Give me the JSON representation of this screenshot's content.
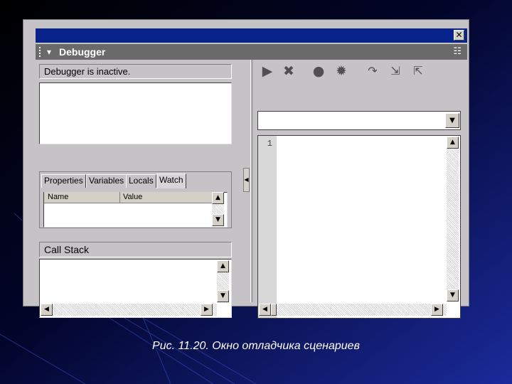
{
  "window": {
    "panel_title": "Debugger",
    "close_glyph": "✕",
    "collapse_glyph": "▾",
    "options_glyph": "☷"
  },
  "status": {
    "text": "Debugger is inactive."
  },
  "tabs": [
    {
      "label": "Properties"
    },
    {
      "label": "Variables"
    },
    {
      "label": "Locals"
    },
    {
      "label": "Watch",
      "active": true
    }
  ],
  "watch_list": {
    "columns": [
      "Name",
      "Value"
    ]
  },
  "call_stack": {
    "title": "Call Stack"
  },
  "code": {
    "line_numbers": [
      "1"
    ]
  },
  "toolbar": {
    "icons": [
      "continue-icon",
      "stop-debugging-icon",
      "toggle-breakpoint-icon",
      "remove-breakpoints-icon",
      "step-over-icon",
      "step-in-icon",
      "step-out-icon"
    ]
  },
  "caption": {
    "prefix": "Рис. 11.20.",
    "text": "Окно отладчика сценариев"
  },
  "colors": {
    "title_bar": "#08248a",
    "panel_header": "#6a6a6a",
    "window_bg": "#c6c3c6"
  }
}
